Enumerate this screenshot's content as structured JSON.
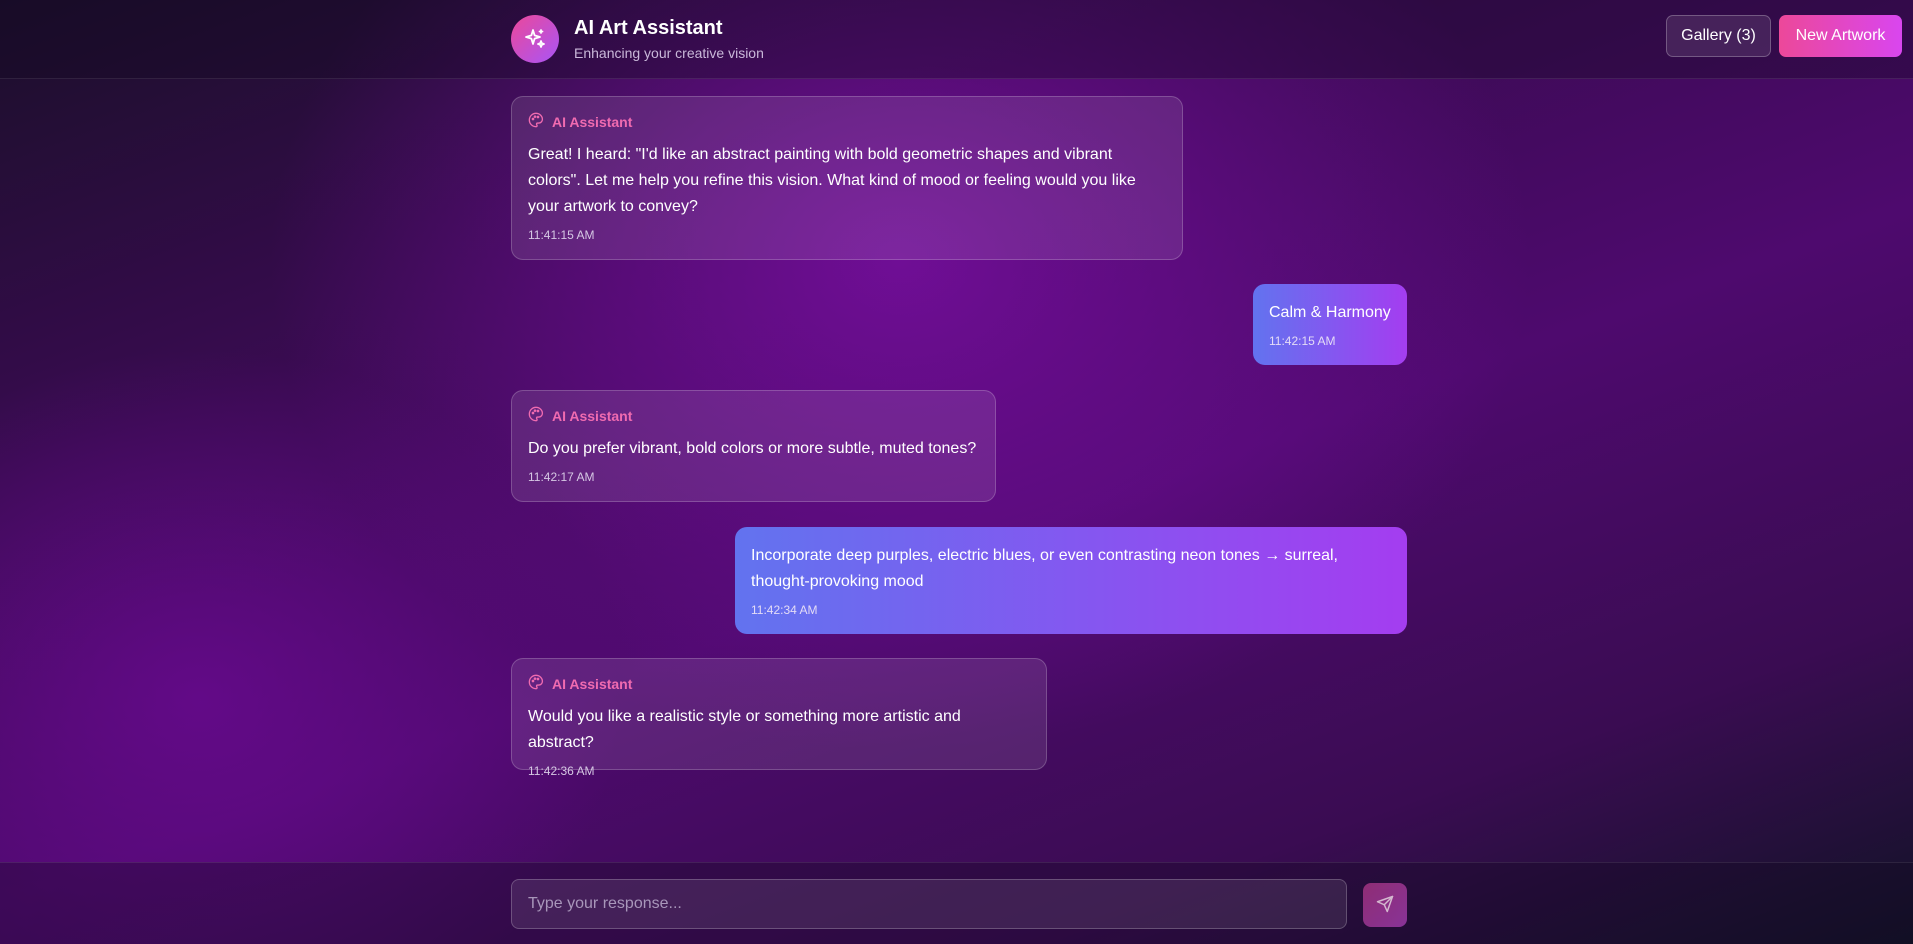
{
  "header": {
    "title": "AI Art Assistant",
    "subtitle": "Enhancing your creative vision",
    "gallery_label": "Gallery (3)",
    "new_artwork_label": "New Artwork",
    "logo_icon": "sparkles-icon"
  },
  "messages": [
    {
      "role": "assistant",
      "sender": "AI Assistant",
      "icon": "palette-icon",
      "text": "Great! I heard: \"I'd like an abstract painting with bold geometric shapes and vibrant colors\". Let me help you refine this vision. What kind of mood or feeling would you like your artwork to convey?",
      "time": "11:41:15 AM"
    },
    {
      "role": "user",
      "text": "Calm & Harmony",
      "time": "11:42:15 AM"
    },
    {
      "role": "assistant",
      "sender": "AI Assistant",
      "icon": "palette-icon",
      "text": "Do you prefer vibrant, bold colors or more subtle, muted tones?",
      "time": "11:42:17 AM"
    },
    {
      "role": "user",
      "text": "Incorporate deep purples, electric blues, or even contrasting neon tones → surreal, thought-provoking mood",
      "time": "11:42:34 AM"
    },
    {
      "role": "assistant",
      "sender": "AI Assistant",
      "icon": "palette-icon",
      "text": "Would you like a realistic style or something more artistic and abstract?",
      "time": "11:42:36 AM"
    }
  ],
  "composer": {
    "placeholder": "Type your response...",
    "value": "",
    "send_icon": "send-icon"
  },
  "colors": {
    "accent_pink": "#ec4899",
    "accent_purple": "#a855f7",
    "assistant_name": "#f06bb0",
    "user_bubble_start": "#6273ef",
    "user_bubble_end": "#a43df0"
  }
}
